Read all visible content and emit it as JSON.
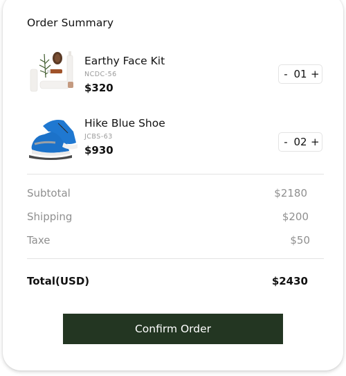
{
  "summary": {
    "title": "Order Summary",
    "items": [
      {
        "name": "Earthy Face Kit",
        "sku": "NCDC-56",
        "price": "$320",
        "quantity": "01",
        "image": "skincare-kit-image"
      },
      {
        "name": "Hike Blue Shoe",
        "sku": "JCBS-63",
        "price": "$930",
        "quantity": "02",
        "image": "blue-sneakers-image"
      }
    ],
    "stepper": {
      "decrement": "-",
      "increment": "+"
    },
    "lines": [
      {
        "label": "Subtotal",
        "value": "$2180"
      },
      {
        "label": "Shipping",
        "value": "$200"
      },
      {
        "label": "Taxe",
        "value": "$50"
      }
    ],
    "total": {
      "label": "Total(USD)",
      "value": "$2430"
    },
    "confirm_label": "Confirm Order"
  },
  "colors": {
    "button_bg": "#233622",
    "muted_text": "#8f8f8f",
    "divider": "#e2e2e2"
  }
}
